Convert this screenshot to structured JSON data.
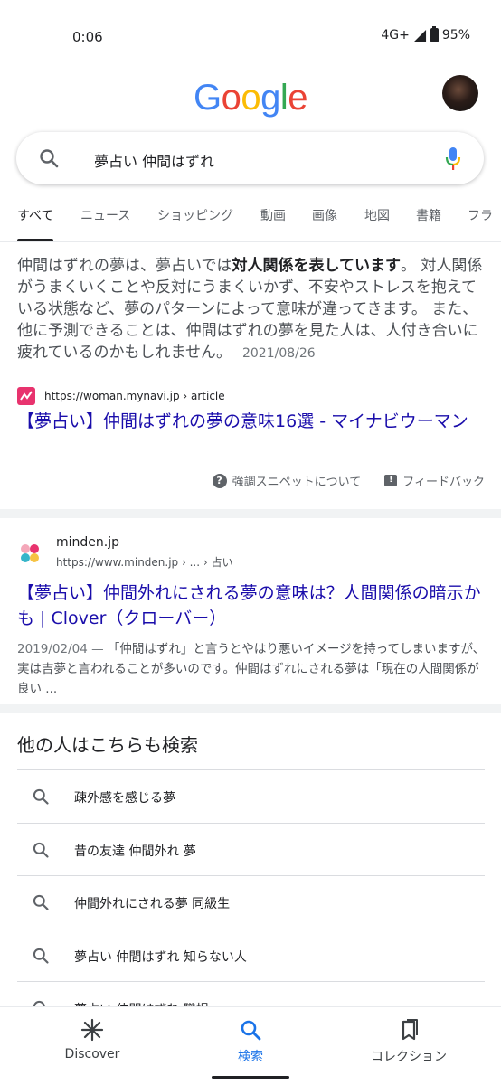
{
  "status": {
    "time": "0:06",
    "network": "4G+",
    "battery": "95%"
  },
  "header": {
    "logo": [
      "G",
      "o",
      "o",
      "g",
      "l",
      "e"
    ],
    "logo_colors": [
      "#4285F4",
      "#EA4335",
      "#FBBC05",
      "#4285F4",
      "#34A853",
      "#EA4335"
    ]
  },
  "search": {
    "query": "夢占い 仲間はずれ"
  },
  "tabs": [
    "すべて",
    "ニュース",
    "ショッピング",
    "動画",
    "画像",
    "地図",
    "書籍",
    "フラ"
  ],
  "snippet": {
    "text_pre": "仲間はずれの夢は、夢占いでは",
    "text_bold": "対人関係を表しています",
    "text_post": "。 対人関係がうまくいくことや反対にうまくいかず、不安やストレスを抱えている状態など、夢のパターンによって意味が違ってきます。 また、他に予測できることは、仲間はずれの夢を見た人は、人付き合いに疲れているのかもしれません。",
    "date": "2021/08/26",
    "source_url": "https://woman.mynavi.jp › article",
    "title": "【夢占い】仲間はずれの夢の意味16選 - マイナビウーマン",
    "about_label": "強調スニペットについて",
    "feedback_label": "フィードバック"
  },
  "result2": {
    "site": "minden.jp",
    "url": "https://www.minden.jp › ... › 占い",
    "title": "【夢占い】仲間外れにされる夢の意味は？人間関係の暗示かも | Clover（クローバー）",
    "date": "2019/02/04 —",
    "description": " 「仲間はずれ」と言うとやはり悪いイメージを持ってしまいますが、実は吉夢と言われることが多いのです。仲間はずれにされる夢は「現在の人間関係が良い ..."
  },
  "related": {
    "title": "他の人はこちらも検索",
    "items": [
      "疎外感を感じる夢",
      "昔の友達 仲間外れ 夢",
      "仲間外れにされる夢 同級生",
      "夢占い 仲間はずれ 知らない人",
      "夢占い 仲間はずれ 職場"
    ]
  },
  "bottom_nav": [
    {
      "label": "Discover",
      "icon": "asterisk-icon"
    },
    {
      "label": "検索",
      "icon": "search-icon"
    },
    {
      "label": "コレクション",
      "icon": "collections-icon"
    }
  ],
  "accent": "#1a73e8",
  "link_color": "#1a0dab"
}
